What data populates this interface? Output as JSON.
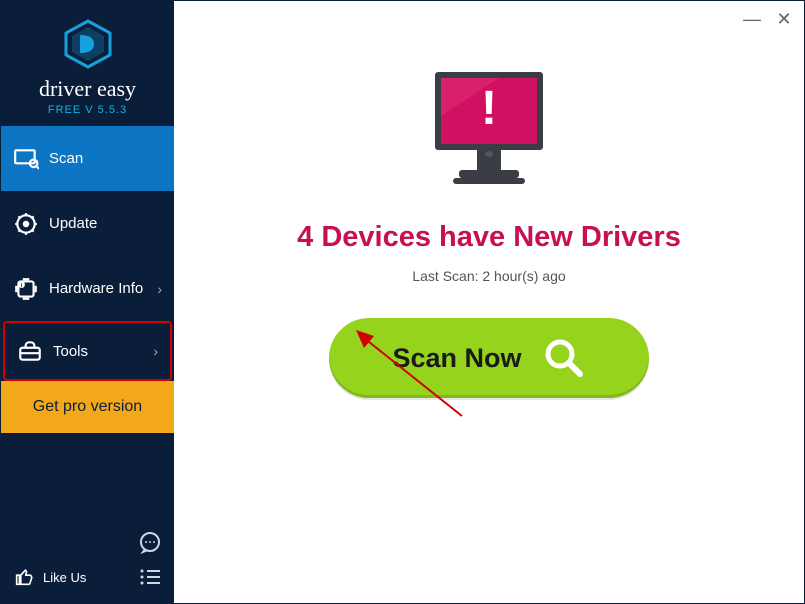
{
  "app": {
    "brand": "driver easy",
    "version": "FREE V 5.5.3"
  },
  "sidebar": {
    "items": [
      {
        "label": "Scan"
      },
      {
        "label": "Update"
      },
      {
        "label": "Hardware Info"
      },
      {
        "label": "Tools"
      }
    ],
    "pro_label": "Get pro version",
    "like_label": "Like Us"
  },
  "main": {
    "headline": "4 Devices have New Drivers",
    "subline": "Last Scan: 2 hour(s) ago",
    "scan_button_label": "Scan Now"
  }
}
